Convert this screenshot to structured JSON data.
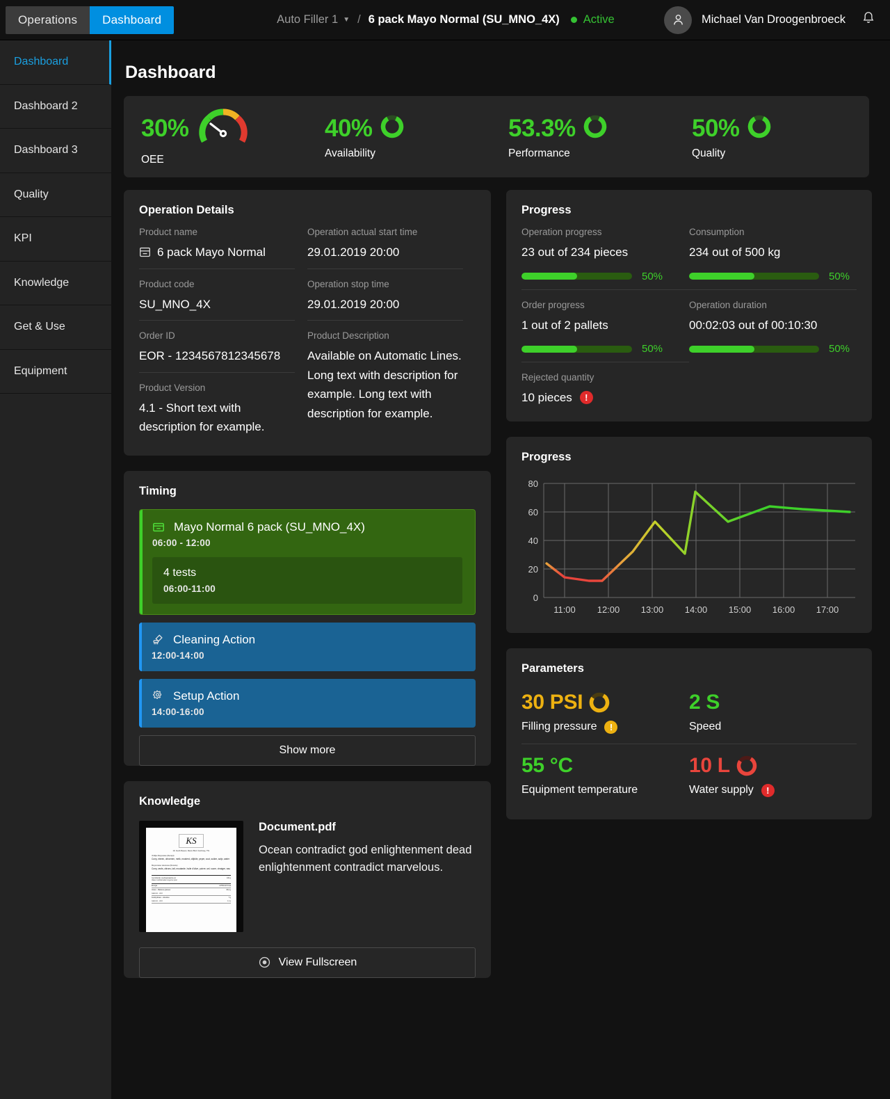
{
  "header": {
    "segments": [
      {
        "label": "Operations",
        "active": false
      },
      {
        "label": "Dashboard",
        "active": true
      }
    ],
    "breadcrumb_machine": "Auto Filler 1",
    "breadcrumb_separator": "/",
    "breadcrumb_product": "6 pack Mayo Normal (SU_MNO_4X)",
    "status": "Active",
    "status_color": "#35c233",
    "user_name": "Michael Van Droogenbroeck",
    "avatar_icon": "user-icon",
    "notification_icon": "bell-icon",
    "chevron_icon": "chevron-down-icon"
  },
  "sidebar": {
    "items": [
      {
        "label": "Dashboard",
        "active": true
      },
      {
        "label": "Dashboard 2",
        "active": false
      },
      {
        "label": "Dashboard 3",
        "active": false
      },
      {
        "label": "Quality",
        "active": false
      },
      {
        "label": "KPI",
        "active": false
      },
      {
        "label": "Knowledge",
        "active": false
      },
      {
        "label": "Get & Use",
        "active": false
      },
      {
        "label": "Equipment",
        "active": false
      }
    ],
    "active_color": "#1a9fe0"
  },
  "page": {
    "title": "Dashboard"
  },
  "kpis": [
    {
      "value": "30%",
      "label": "OEE",
      "indicator": "gauge",
      "percent": 30,
      "color": "#3ed02a"
    },
    {
      "value": "40%",
      "label": "Availability",
      "indicator": "ring",
      "percent": 40,
      "color": "#3ed02a"
    },
    {
      "value": "53.3%",
      "label": "Performance",
      "indicator": "ring",
      "percent": 53.3,
      "color": "#3ed02a"
    },
    {
      "value": "50%",
      "label": "Quality",
      "indicator": "ring",
      "percent": 50,
      "color": "#3ed02a"
    }
  ],
  "operation_details": {
    "title": "Operation Details",
    "left": [
      {
        "label": "Product name",
        "value": "6 pack Mayo Normal",
        "icon": "product-box-icon"
      },
      {
        "label": "Product code",
        "value": "SU_MNO_4X"
      },
      {
        "label": "Order ID",
        "value": "EOR - 1234567812345678"
      },
      {
        "label": "Product Version",
        "value": "4.1 - Short text with description for example."
      }
    ],
    "right": [
      {
        "label": "Operation actual start time",
        "value": "29.01.2019 20:00"
      },
      {
        "label": "Operation stop time",
        "value": "29.01.2019 20:00"
      },
      {
        "label": "Product Description",
        "value": "Available on Automatic Lines. Long text with description for example. Long text with description for example."
      }
    ]
  },
  "progress_panel": {
    "title": "Progress",
    "cells": [
      {
        "label": "Operation progress",
        "value": "23 out of 234 pieces",
        "percent": 50,
        "percent_label": "50%"
      },
      {
        "label": "Consumption",
        "value": "234 out of 500 kg",
        "percent": 50,
        "percent_label": "50%"
      },
      {
        "label": "Order progress",
        "value": "1 out of 2 pallets",
        "percent": 50,
        "percent_label": "50%"
      },
      {
        "label": "Operation duration",
        "value": "00:02:03 out of 00:10:30",
        "percent": 50,
        "percent_label": "50%"
      }
    ],
    "rejected": {
      "label": "Rejected quantity",
      "value": "10 pieces",
      "badge": "!",
      "badge_color": "#e02b2b"
    }
  },
  "chart_data": {
    "type": "line",
    "title": "Progress",
    "xlabel": "",
    "ylabel": "",
    "ylim": [
      0,
      80
    ],
    "yticks": [
      0,
      20,
      40,
      60,
      80
    ],
    "xticks": [
      "11:00",
      "12:00",
      "13:00",
      "14:00",
      "15:00",
      "16:00",
      "17:00"
    ],
    "grid": true,
    "legend": "none",
    "x": [
      "10:40",
      "10:55",
      "11:20",
      "11:45",
      "12:30",
      "13:05",
      "13:45",
      "14:00",
      "14:50",
      "15:45",
      "16:30",
      "17:15"
    ],
    "values": [
      24,
      14,
      12,
      12,
      32,
      53,
      31,
      74,
      53,
      64,
      62,
      60
    ],
    "line_gradient": [
      "#e8453c",
      "#e8a33c",
      "#c5d12a",
      "#3ed02a"
    ]
  },
  "parameters_panel": {
    "title": "Parameters",
    "items": [
      {
        "value": "30 PSI",
        "label": "Filling pressure",
        "color": "#edb111",
        "ring_percent": 75,
        "badge": "!",
        "badge_color": "#edb111"
      },
      {
        "value": "2 S",
        "label": "Speed",
        "color": "#3ed02a",
        "ring_percent": 0,
        "badge": "",
        "badge_color": ""
      },
      {
        "value": "55 °C",
        "label": "Equipment temperature",
        "color": "#3ed02a",
        "ring_percent": 0,
        "badge": "",
        "badge_color": ""
      },
      {
        "value": "10 L",
        "label": "Water supply",
        "color": "#e8453c",
        "ring_percent": 75,
        "badge": "!",
        "badge_color": "#e02b2b"
      }
    ]
  },
  "timing_panel": {
    "title": "Timing",
    "entries": [
      {
        "name": "Mayo Normal 6 pack (SU_MNO_4X)",
        "time": "06:00 - 12:00",
        "type": "green",
        "icon": "product-box-icon",
        "sub": {
          "name": "4 tests",
          "time": "06:00-11:00"
        }
      },
      {
        "name": "Cleaning Action",
        "time": "12:00-14:00",
        "type": "blue",
        "icon": "brush-icon",
        "sub": null
      },
      {
        "name": "Setup Action",
        "time": "14:00-16:00",
        "type": "blue",
        "icon": "gear-icon",
        "sub": null
      }
    ],
    "show_more": "Show more"
  },
  "knowledge_panel": {
    "title": "Knowledge",
    "doc_title": "Document.pdf",
    "doc_desc": "Ocean contradict god enlightenment dead enlightenment contradict marvelous.",
    "thumbnail": {
      "monogram": "KS",
      "address": "18, South Beaver, Manor Blvd. Ketchway, TW.",
      "section1_title": "Vrölijke Mayonaise (Recept):",
      "section1_body": "Curry, eieren, citroenen, melk, mosterd, olijfolie, peper, zout, suiker, azijn, water",
      "section2_title": "Mayonnaise Heureuse (Recette):",
      "section2_body": "Curry, œufs, citrons, lait, moutarde, huile d'olive, poivre, sel, sucre, vinaigre, eau",
      "nutrition_header_left": "Gemiddelde voedingswaarde per\nValeur nutritionnelle moyenne pour",
      "nutrition_header_right": "100 g",
      "rows": [
        {
          "l": "Energie",
          "r": "1375KJ/23 Kcal"
        },
        {
          "l": "Vetten - Matières grasses",
          "r": "36,0 g"
        },
        {
          "l": "waarvan - dont",
          "r": ""
        },
        {
          "l": "Koolhydraten - Glucides",
          "r": "7 g"
        },
        {
          "l": "waarvan - dont",
          "r": "1,1 g"
        }
      ]
    },
    "fullscreen_label": "View Fullscreen",
    "fullscreen_icon": "eye-icon"
  }
}
